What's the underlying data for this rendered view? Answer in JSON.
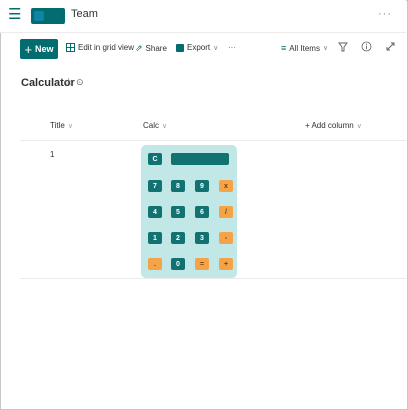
{
  "header": {
    "site_title": "Team",
    "more": "···"
  },
  "commandbar": {
    "new_label": "New",
    "grid_view": "Edit in grid view",
    "share": "Share",
    "export": "Export",
    "more": "···",
    "view": "All Items"
  },
  "list": {
    "title": "Calculator"
  },
  "columns": {
    "title": "Title",
    "calc": "Calc",
    "add": "+ Add column"
  },
  "rows": [
    {
      "title": "1"
    }
  ],
  "calculator": {
    "rows": [
      [
        "C"
      ],
      [
        "7",
        "8",
        "9",
        "x"
      ],
      [
        "4",
        "5",
        "6",
        "/"
      ],
      [
        "1",
        "2",
        "3",
        "-"
      ],
      [
        ".",
        "0",
        "=",
        "+"
      ]
    ]
  },
  "colors": {
    "accent": "#036c70",
    "calc_bg": "#c2e7e7",
    "key_dark": "#127272",
    "key_op": "#f4a349"
  },
  "icons": [
    "menu-icon",
    "site-logo",
    "star-icon",
    "sync-icon",
    "grid-icon",
    "share-icon",
    "excel-icon",
    "filter-icon",
    "info-icon",
    "expand-icon"
  ]
}
